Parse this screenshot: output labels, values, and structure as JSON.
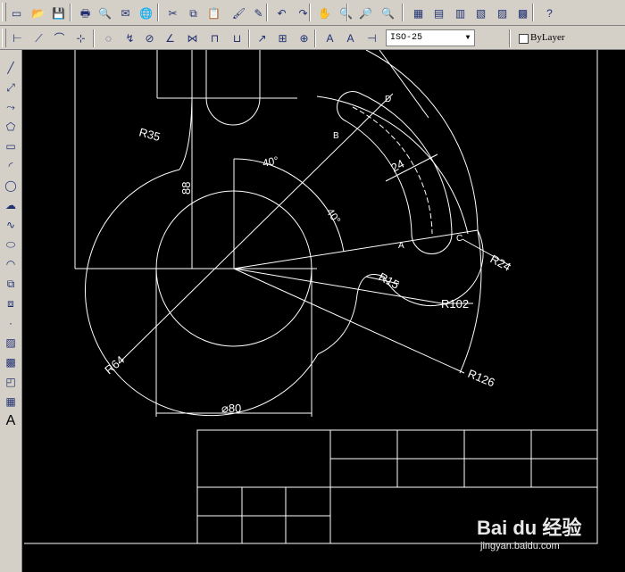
{
  "toolbar_standard": {
    "buttons": [
      {
        "name": "new-icon",
        "glyph": "▭"
      },
      {
        "name": "open-icon",
        "glyph": "📂"
      },
      {
        "name": "save-icon",
        "glyph": "💾"
      },
      {
        "name": "print-icon",
        "glyph": "🖶"
      },
      {
        "name": "print-preview-icon",
        "glyph": "🔍"
      },
      {
        "name": "publish-icon",
        "glyph": "✉"
      },
      {
        "name": "etransmit-icon",
        "glyph": "🌐"
      },
      {
        "name": "cut-icon",
        "glyph": "✂"
      },
      {
        "name": "copy-icon",
        "glyph": "⧉"
      },
      {
        "name": "paste-icon",
        "glyph": "📋"
      },
      {
        "name": "match-properties-icon",
        "glyph": "🖌"
      },
      {
        "name": "block-editor-icon",
        "glyph": "✎"
      },
      {
        "name": "undo-icon",
        "glyph": "↶"
      },
      {
        "name": "redo-icon",
        "glyph": "↷"
      },
      {
        "name": "pan-icon",
        "glyph": "✋"
      },
      {
        "name": "zoom-realtime-icon",
        "glyph": "🔍"
      },
      {
        "name": "zoom-window-icon",
        "glyph": "🔎"
      },
      {
        "name": "zoom-previous-icon",
        "glyph": "🔍"
      },
      {
        "name": "properties-icon",
        "glyph": "▦"
      },
      {
        "name": "design-center-icon",
        "glyph": "▤"
      },
      {
        "name": "tool-palettes-icon",
        "glyph": "▥"
      },
      {
        "name": "sheet-set-manager-icon",
        "glyph": "▧"
      },
      {
        "name": "markup-set-manager-icon",
        "glyph": "▨"
      },
      {
        "name": "calculator-icon",
        "glyph": "▩"
      },
      {
        "name": "help-icon",
        "glyph": "?"
      }
    ]
  },
  "toolbar_dimension": {
    "buttons": [
      {
        "name": "linear-dimension-icon",
        "glyph": "⊢"
      },
      {
        "name": "aligned-dimension-icon",
        "glyph": "⟋"
      },
      {
        "name": "arc-length-icon",
        "glyph": "⌒"
      },
      {
        "name": "ordinate-dimension-icon",
        "glyph": "⊹"
      },
      {
        "name": "radius-dimension-icon",
        "glyph": "◌"
      },
      {
        "name": "jogged-dimension-icon",
        "glyph": "↯"
      },
      {
        "name": "diameter-dimension-icon",
        "glyph": "⊘"
      },
      {
        "name": "angular-dimension-icon",
        "glyph": "∠"
      },
      {
        "name": "quick-dimension-icon",
        "glyph": "⋈"
      },
      {
        "name": "baseline-dimension-icon",
        "glyph": "⊓"
      },
      {
        "name": "continue-dimension-icon",
        "glyph": "⊔"
      },
      {
        "name": "quick-leader-icon",
        "glyph": "↗"
      },
      {
        "name": "tolerance-icon",
        "glyph": "⊞"
      },
      {
        "name": "center-mark-icon",
        "glyph": "⊕"
      },
      {
        "name": "dimension-edit-icon",
        "glyph": "A"
      },
      {
        "name": "dimension-text-edit-icon",
        "glyph": "A"
      },
      {
        "name": "dimension-update-icon",
        "glyph": "⊣"
      }
    ],
    "dim_style": "ISO-25",
    "dim_style_dropdown_glyph": "▼",
    "layer_label": "ByLayer"
  },
  "toolbar_draw": {
    "buttons": [
      {
        "name": "line-icon",
        "glyph": "╱"
      },
      {
        "name": "construction-line-icon",
        "glyph": "⤢"
      },
      {
        "name": "polyline-icon",
        "glyph": "⤳"
      },
      {
        "name": "polygon-icon",
        "glyph": "⬠"
      },
      {
        "name": "rectangle-icon",
        "glyph": "▭"
      },
      {
        "name": "arc-icon",
        "glyph": "◜"
      },
      {
        "name": "circle-icon",
        "glyph": "◯"
      },
      {
        "name": "revision-cloud-icon",
        "glyph": "☁"
      },
      {
        "name": "spline-icon",
        "glyph": "∿"
      },
      {
        "name": "ellipse-icon",
        "glyph": "⬭"
      },
      {
        "name": "ellipse-arc-icon",
        "glyph": "◠"
      },
      {
        "name": "insert-block-icon",
        "glyph": "⧉"
      },
      {
        "name": "make-block-icon",
        "glyph": "⧈"
      },
      {
        "name": "point-icon",
        "glyph": "·"
      },
      {
        "name": "hatch-icon",
        "glyph": "▨"
      },
      {
        "name": "gradient-icon",
        "glyph": "▩"
      },
      {
        "name": "region-icon",
        "glyph": "◰"
      },
      {
        "name": "table-icon",
        "glyph": "▦"
      },
      {
        "name": "multiline-text-icon",
        "glyph": "A"
      }
    ]
  },
  "drawing": {
    "labels": {
      "r35": "R35",
      "r64": "R64",
      "r24": "R24",
      "r15": "R15",
      "r102": "R102",
      "r126": "R126",
      "dia80": "⌀80",
      "dim88": "88",
      "dim24": "24",
      "ang40a": "40°",
      "ang40b": "40°",
      "pt_a": "A",
      "pt_b": "B",
      "pt_c": "C",
      "pt_d": "D"
    },
    "line_color": "#ffffff",
    "background": "#000000"
  },
  "watermark": {
    "main": "Bai du 经验",
    "sub": "jingyan.baidu.com"
  }
}
